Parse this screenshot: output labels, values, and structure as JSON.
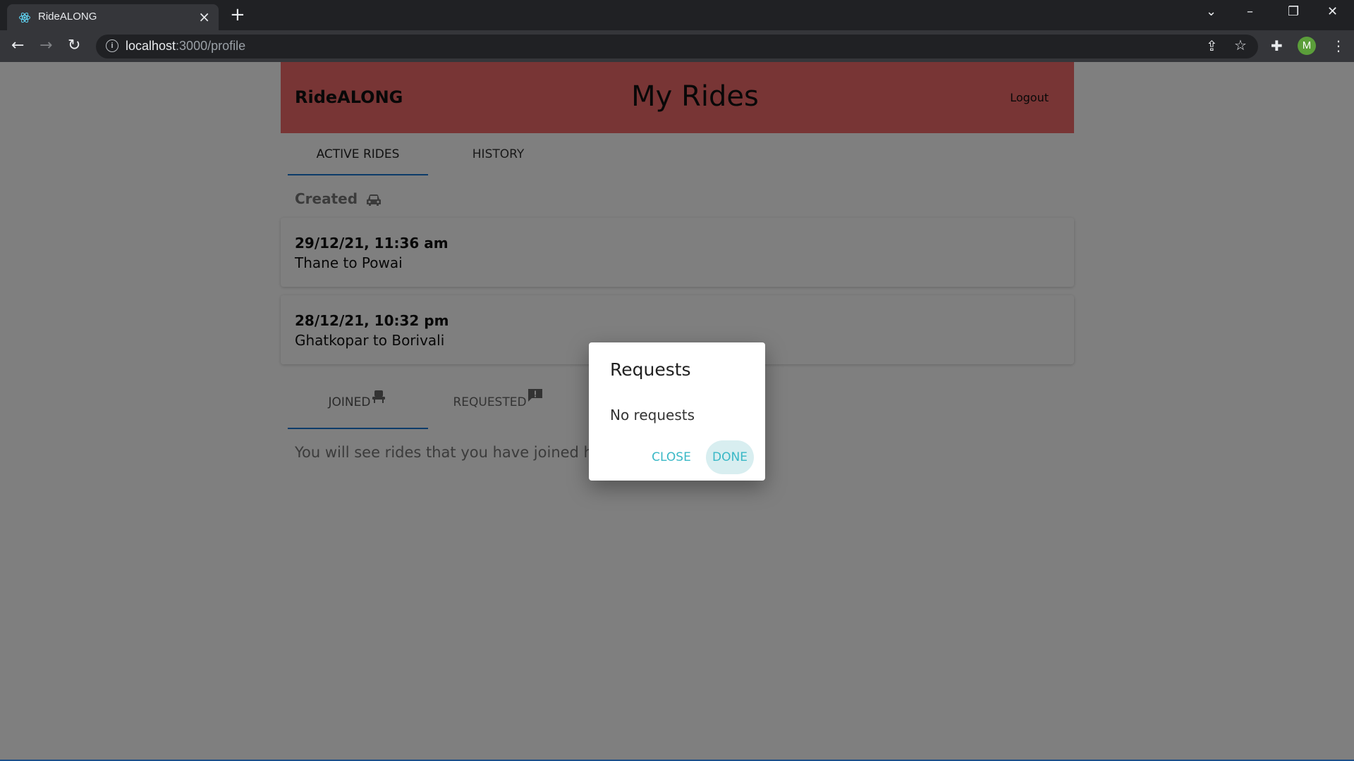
{
  "browser": {
    "tab_title": "RideALONG",
    "url_host": "localhost",
    "url_rest": ":3000/profile",
    "profile_initial": "M"
  },
  "header": {
    "brand": "RideALONG",
    "title": "My Rides",
    "logout": "Logout",
    "color": "#f06a6a"
  },
  "tabs_top": [
    {
      "label": "ACTIVE RIDES",
      "active": true
    },
    {
      "label": "HISTORY",
      "active": false
    }
  ],
  "created_section": {
    "title": "Created",
    "icon": "car-icon"
  },
  "rides": [
    {
      "datetime": "29/12/21, 11:36 am",
      "route": "Thane to Powai"
    },
    {
      "datetime": "28/12/21, 10:32 pm",
      "route": "Ghatkopar to Borivali"
    }
  ],
  "tabs_bottom": [
    {
      "label": "JOINED",
      "icon": "seat-icon",
      "active": true
    },
    {
      "label": "REQUESTED",
      "icon": "feedback-icon",
      "active": false
    }
  ],
  "empty_message": "You will see rides that you have joined her",
  "dialog": {
    "title": "Requests",
    "body": "No requests",
    "close": "CLOSE",
    "done": "DONE",
    "accent": "#39b8c6"
  }
}
